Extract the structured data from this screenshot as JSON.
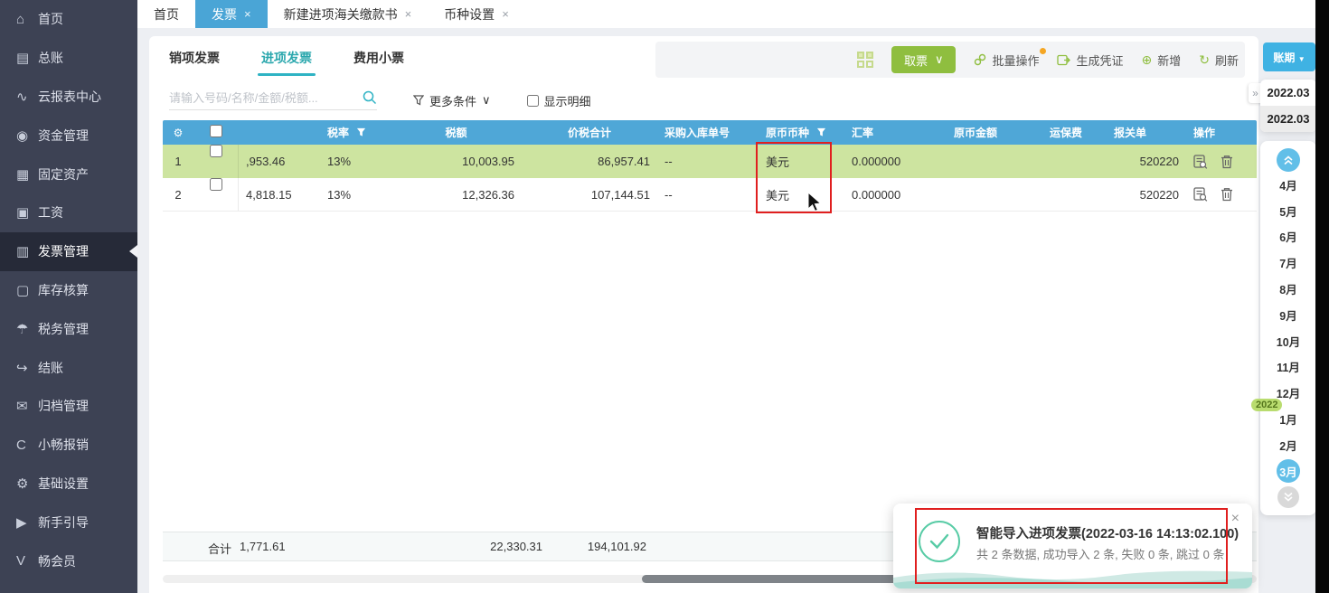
{
  "window": {
    "close_glyph": "×"
  },
  "sidebar": {
    "items": [
      {
        "icon": "⌂",
        "label": "首页"
      },
      {
        "icon": "▤",
        "label": "总账"
      },
      {
        "icon": "∿",
        "label": "云报表中心"
      },
      {
        "icon": "◉",
        "label": "资金管理"
      },
      {
        "icon": "▦",
        "label": "固定资产"
      },
      {
        "icon": "▣",
        "label": "工资"
      },
      {
        "icon": "▥",
        "label": "发票管理"
      },
      {
        "icon": "▢",
        "label": "库存核算"
      },
      {
        "icon": "☂",
        "label": "税务管理"
      },
      {
        "icon": "↪",
        "label": "结账"
      },
      {
        "icon": "✉",
        "label": "归档管理"
      },
      {
        "icon": "C",
        "label": "小畅报销"
      },
      {
        "icon": "⚙",
        "label": "基础设置"
      },
      {
        "icon": "▶",
        "label": "新手引导"
      },
      {
        "icon": "V",
        "label": "畅会员"
      }
    ]
  },
  "tabbar": {
    "home": "首页",
    "tabs": [
      {
        "label": "发票"
      },
      {
        "label": "新建进项海关缴款书"
      },
      {
        "label": "币种设置"
      }
    ]
  },
  "toolbar": {
    "invoice_tabs": [
      "销项发票",
      "进项发票",
      "费用小票"
    ],
    "get_ticket": "取票",
    "batch": "批量操作",
    "make_voucher": "生成凭证",
    "add": "新增",
    "refresh": "刷新"
  },
  "filters": {
    "search_placeholder": "请输入号码/名称/金额/税额...",
    "more_conditions": "更多条件",
    "show_detail": "显示明细"
  },
  "table": {
    "headers": {
      "rate": "税率",
      "tax": "税额",
      "total": "价税合计",
      "purchase": "采购入库单号",
      "currency": "原币币种",
      "exrate": "汇率",
      "orig_amount": "原币金额",
      "freight": "运保费",
      "customs": "报关单",
      "ops": "操作"
    },
    "rows": [
      {
        "seq": "1",
        "amount": ",953.46",
        "rate": "13%",
        "tax": "10,003.95",
        "total": "86,957.41",
        "purchase": "--",
        "currency": "美元",
        "exrate": "0.000000",
        "customs": "520220"
      },
      {
        "seq": "2",
        "amount": "4,818.15",
        "rate": "13%",
        "tax": "12,326.36",
        "total": "107,144.51",
        "purchase": "--",
        "currency": "美元",
        "exrate": "0.000000",
        "customs": "520220"
      }
    ],
    "footer": {
      "label": "合计",
      "amount": "1,771.61",
      "tax": "22,330.31",
      "total": "194,101.92"
    }
  },
  "period": {
    "button_label": "账期",
    "entries": [
      "2022.03",
      "2022.03"
    ],
    "months": [
      "4月",
      "5月",
      "6月",
      "7月",
      "8月",
      "9月",
      "10月",
      "11月",
      "12月",
      "1月",
      "2月",
      "3月"
    ],
    "active_month": "3月",
    "year_badge": "2022"
  },
  "toast": {
    "title": "智能导入进项发票(2022-03-16 14:13:02.100)",
    "body": "共 2 条数据, 成功导入 2 条, 失败 0 条, 跳过 0 条"
  },
  "icons": {
    "gear": "⚙",
    "plus_circle": "⊕",
    "refresh": "↻",
    "chevron_down": "∨",
    "caret_down": "▼",
    "collapse": "»"
  },
  "colors": {
    "accent_blue": "#4aa5d6",
    "accent_teal": "#2aa7ad",
    "accent_green": "#8fbe3f",
    "row_highlight": "#cde4a0",
    "annotation_red": "#e01f1f"
  }
}
